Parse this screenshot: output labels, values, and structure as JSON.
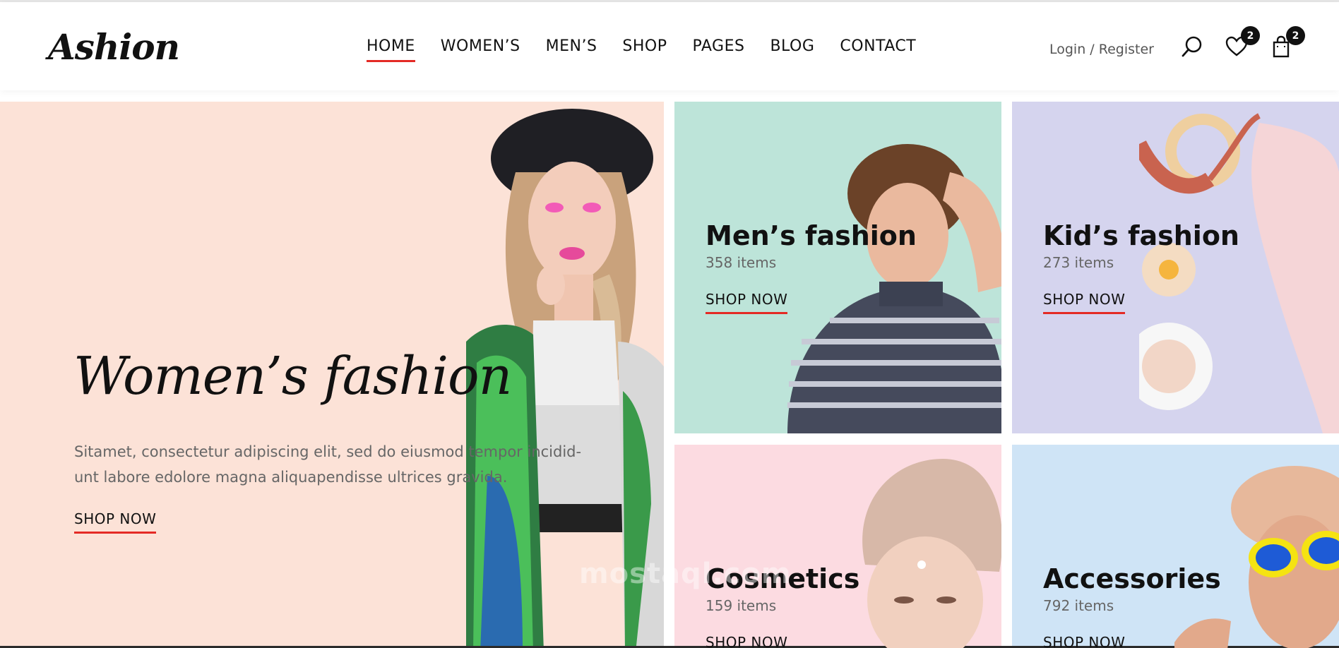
{
  "brand": {
    "logo": "Ashion"
  },
  "nav": {
    "items": [
      {
        "label": "HOME",
        "active": true
      },
      {
        "label": "WOMEN’S",
        "active": false
      },
      {
        "label": "MEN’S",
        "active": false
      },
      {
        "label": "SHOP",
        "active": false
      },
      {
        "label": "PAGES",
        "active": false
      },
      {
        "label": "BLOG",
        "active": false
      },
      {
        "label": "CONTACT",
        "active": false
      }
    ]
  },
  "header_actions": {
    "login_label": "Login / Register",
    "search_icon": "search-icon",
    "wishlist": {
      "icon": "heart-icon",
      "count": "2"
    },
    "cart": {
      "icon": "shopping-bag-icon",
      "count": "2"
    }
  },
  "hero": {
    "title": "Women’s fashion",
    "description": "Sitamet, consectetur adipiscing elit, sed do eiusmod tempor incidid- unt labore edolore magna aliquapendisse ultrices gravida.",
    "cta": "SHOP NOW"
  },
  "categories": [
    {
      "title": "Men’s fashion",
      "count": "358 items",
      "cta": "SHOP NOW",
      "bg": "#bde4d9"
    },
    {
      "title": "Kid’s fashion",
      "count": "273 items",
      "cta": "SHOP NOW",
      "bg": "#d5d4ee"
    },
    {
      "title": "Cosmetics",
      "count": "159 items",
      "cta": "SHOP NOW",
      "bg": "#fcdbe1"
    },
    {
      "title": "Accessories",
      "count": "792 items",
      "cta": "SHOP NOW",
      "bg": "#cfe4f6"
    }
  ],
  "watermark": "mostaql.com",
  "colors": {
    "accent": "#e42a25",
    "hero_bg": "#fce2d7",
    "text": "#111111",
    "muted": "#666666"
  }
}
